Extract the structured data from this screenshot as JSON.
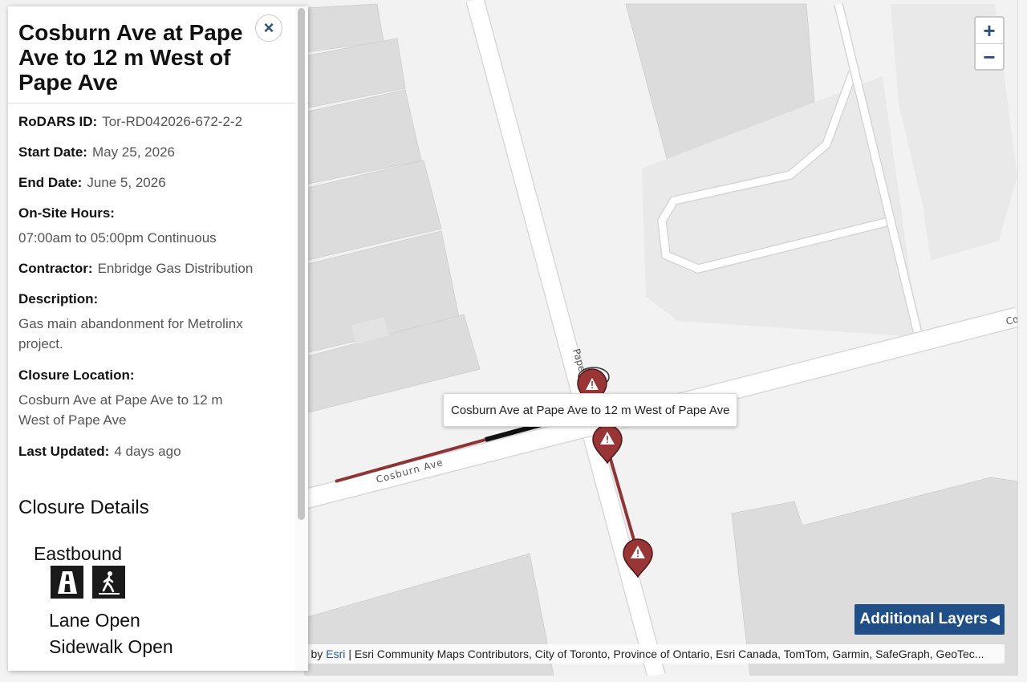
{
  "panel": {
    "title": "Cosburn Ave at Pape Ave to 12 m West of Pape Ave",
    "close_symbol": "×",
    "rodars_label": "RoDARS ID:",
    "rodars_value": "Tor-RD042026-672-2-2",
    "start_label": "Start Date:",
    "start_value": "May 25, 2026",
    "end_label": "End Date:",
    "end_value": "June 5, 2026",
    "hours_label": "On-Site Hours:",
    "hours_value": "07:00am to 05:00pm Continuous",
    "contractor_label": "Contractor:",
    "contractor_value": "Enbridge Gas Distribution",
    "description_label": "Description:",
    "description_value": "Gas main abandonment for Metrolinx project.",
    "location_label": "Closure Location:",
    "location_value": "Cosburn Ave at Pape Ave to 12 m West of Pape Ave",
    "updated_label": "Last Updated:",
    "updated_value": "4 days ago",
    "details_title": "Closure Details",
    "direction": "Eastbound",
    "icons": [
      "road-lane-icon",
      "pedestrian-icon"
    ],
    "lane_status": "Lane Open",
    "sidewalk_status": "Sidewalk Open"
  },
  "map": {
    "zoom_in": "+",
    "zoom_out": "−",
    "tooltip": "Cosburn Ave at Pape Ave to 12 m West of Pape Ave",
    "street_labels": [
      "Cosburn Ave",
      "Pape",
      "Co"
    ],
    "layers_button": "Additional Layers",
    "layers_arrow": "◀",
    "attribution_prefix": "ed by",
    "attribution_link": "Esri",
    "attribution_rest": "| Esri Community Maps Contributors, City of Toronto, Province of Ontario, Esri Canada, TomTom, Garmin, SafeGraph, GeoTec...",
    "marker_icon": "warning-marker-icon",
    "colors": {
      "closure_line": "#8e3434",
      "marker": "#9a3535",
      "button": "#1f4f86"
    }
  }
}
